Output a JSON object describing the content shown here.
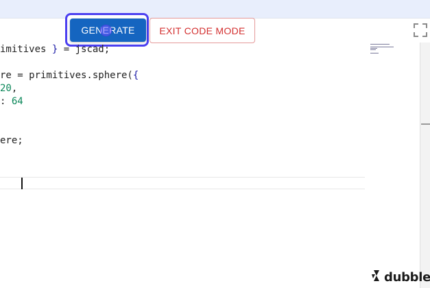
{
  "toolbar": {
    "generate_label": "GENERATE",
    "exit_label": "EXIT CODE MODE"
  },
  "editor": {
    "lines": [
      {
        "parts": [
          "imitives ",
          "}",
          " = jscad;"
        ]
      },
      {
        "parts": [
          "re = primitives.sphere(",
          "{"
        ]
      },
      {
        "parts": [
          "20",
          ","
        ]
      },
      {
        "parts": [
          ": ",
          "64"
        ]
      },
      {
        "parts": [
          "ere;"
        ]
      }
    ]
  },
  "branding": {
    "logo_text": "dubble",
    "logo_icon": "dubble-logo-icon"
  },
  "colors": {
    "accent": "#1565c0",
    "focus_ring": "#4b3ff0",
    "danger": "#d32f2f",
    "number": "#098658",
    "brace": "#1a1aa6"
  }
}
